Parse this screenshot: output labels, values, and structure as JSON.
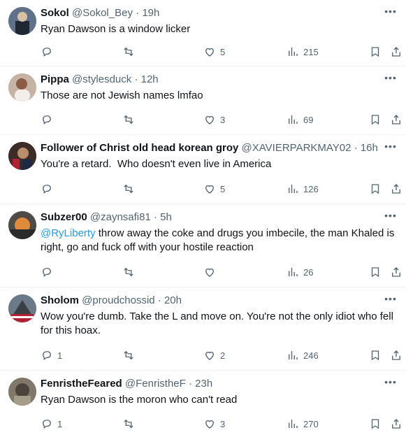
{
  "tweets": [
    {
      "name": "Sokol",
      "handle": "@Sokol_Bey",
      "dot": "·",
      "time": "19h",
      "text": "Ryan Dawson is a window licker",
      "mention": "",
      "replies": "",
      "likes": "5",
      "views": "215",
      "avatar_color": "#6f7f94"
    },
    {
      "name": "Pippa",
      "handle": "@stylesduck",
      "dot": "·",
      "time": "12h",
      "text": "Those are not Jewish names lmfao",
      "mention": "",
      "replies": "",
      "likes": "3",
      "views": "69",
      "avatar_color": "#b99a88"
    },
    {
      "name": "Follower of Christ old head korean groy",
      "handle": "@XAVIERPARKMAY02",
      "dot": "·",
      "time": "16h",
      "text": "You're a retard.  Who doesn't even live in America",
      "mention": "",
      "replies": "",
      "likes": "5",
      "views": "126",
      "avatar_color": "#3a2a25"
    },
    {
      "name": "Subzer00",
      "handle": "@zaynsafi81",
      "dot": "·",
      "time": "5h",
      "text": " throw away the coke and drugs you imbecile, the man Khaled is right, go and fuck off with your hostile reaction",
      "mention": "@RyLiberty",
      "replies": "",
      "likes": "",
      "views": "26",
      "avatar_color": "#4d4a48"
    },
    {
      "name": "Sholom",
      "handle": "@proudchossid",
      "dot": "·",
      "time": "20h",
      "text": "Wow you're dumb. Take the L and move on. You're not the only idiot who fell for this hoax.",
      "mention": "",
      "replies": "1",
      "likes": "2",
      "views": "246",
      "avatar_color": "#5b6a78"
    },
    {
      "name": "FenristheFeared",
      "handle": "@FenristheF",
      "dot": "·",
      "time": "23h",
      "text": "Ryan Dawson is the moron who can't read",
      "mention": "",
      "replies": "1",
      "likes": "3",
      "views": "270",
      "avatar_color": "#777064"
    }
  ]
}
